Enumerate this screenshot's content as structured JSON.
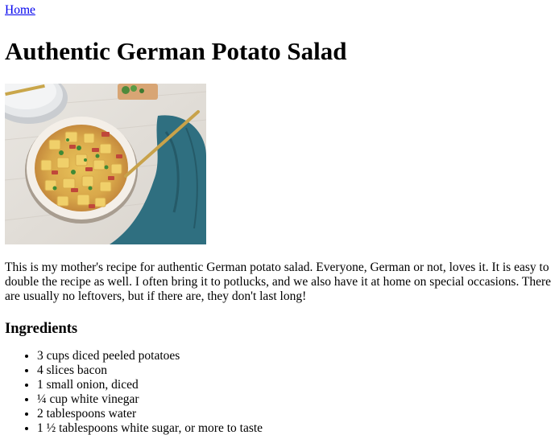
{
  "nav": {
    "home_label": "Home"
  },
  "recipe": {
    "title": "Authentic German Potato Salad",
    "image_alt": "Authentic German Potato Salad",
    "description": "This is my mother's recipe for authentic German potato salad. Everyone, German or not, loves it. It is easy to double the recipe as well. I often bring it to potlucks, and we also have it at home on special occasions. There are usually no leftovers, but if there are, they don't last long!",
    "ingredients_heading": "Ingredients",
    "ingredients": [
      "3 cups diced peeled potatoes",
      "4 slices bacon",
      "1 small onion, diced",
      "¼ cup white vinegar",
      "2 tablespoons water",
      "1 ½ tablespoons white sugar, or more to taste"
    ]
  },
  "colors": {
    "link": "#0000ee",
    "text": "#000000",
    "background": "#ffffff"
  }
}
